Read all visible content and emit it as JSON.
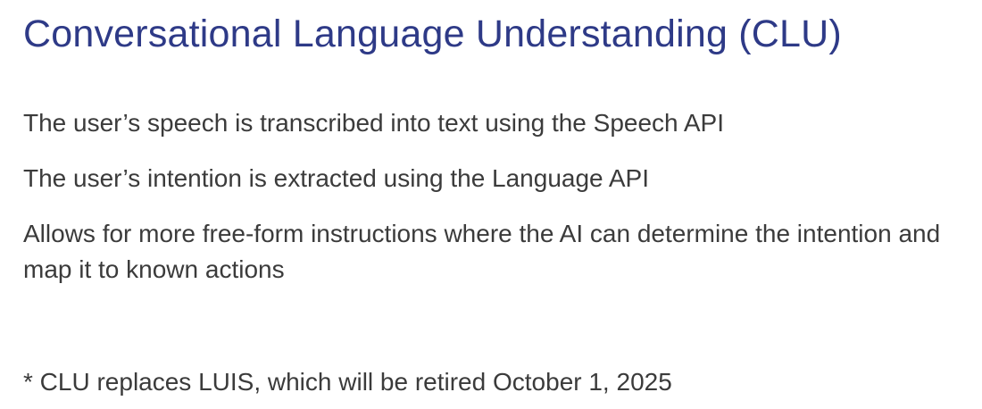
{
  "slide": {
    "title": "Conversational Language Understanding (CLU)",
    "bullets": [
      "The user’s speech is transcribed into text using the Speech API",
      "The user’s intention is extracted using the Language API",
      "Allows for more free-form instructions where the AI can determine the intention and map it to known actions"
    ],
    "footnote": "* CLU replaces LUIS, which will be retired October 1, 2025"
  },
  "colors": {
    "title": "#2e3a87",
    "body_text": "#3b3b3b",
    "background": "#ffffff"
  }
}
